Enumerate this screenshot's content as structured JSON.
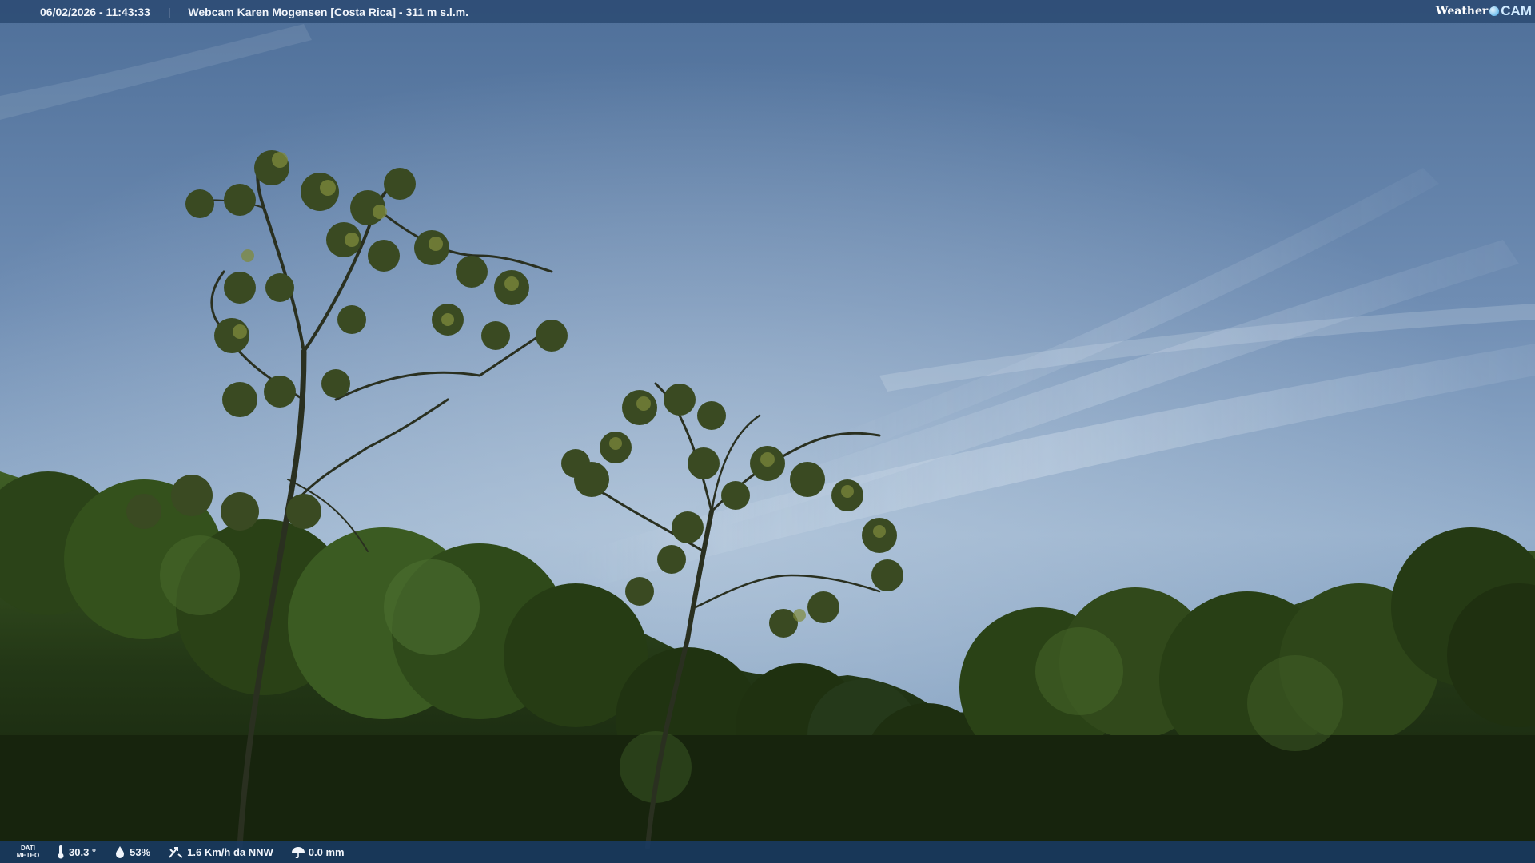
{
  "topbar": {
    "datetime": "06/02/2026 - 11:43:33",
    "separator": "|",
    "title": "Webcam Karen Mogensen [Costa Rica] - 311 m s.l.m."
  },
  "logo": {
    "weather": "Weather",
    "cam": "CAM"
  },
  "bottombar": {
    "label_line1": "DATI",
    "label_line2": "METEO",
    "temperature": "30.3 °",
    "humidity": "53%",
    "wind": "1.6 Km/h da NNW",
    "rain": "0.0 mm"
  },
  "colors": {
    "sky_top": "#4d6f99",
    "sky_mid": "#8aa6c4",
    "foliage_dark": "#1b2a12",
    "foliage_mid": "#3c5a22",
    "bar": "#28466e"
  }
}
